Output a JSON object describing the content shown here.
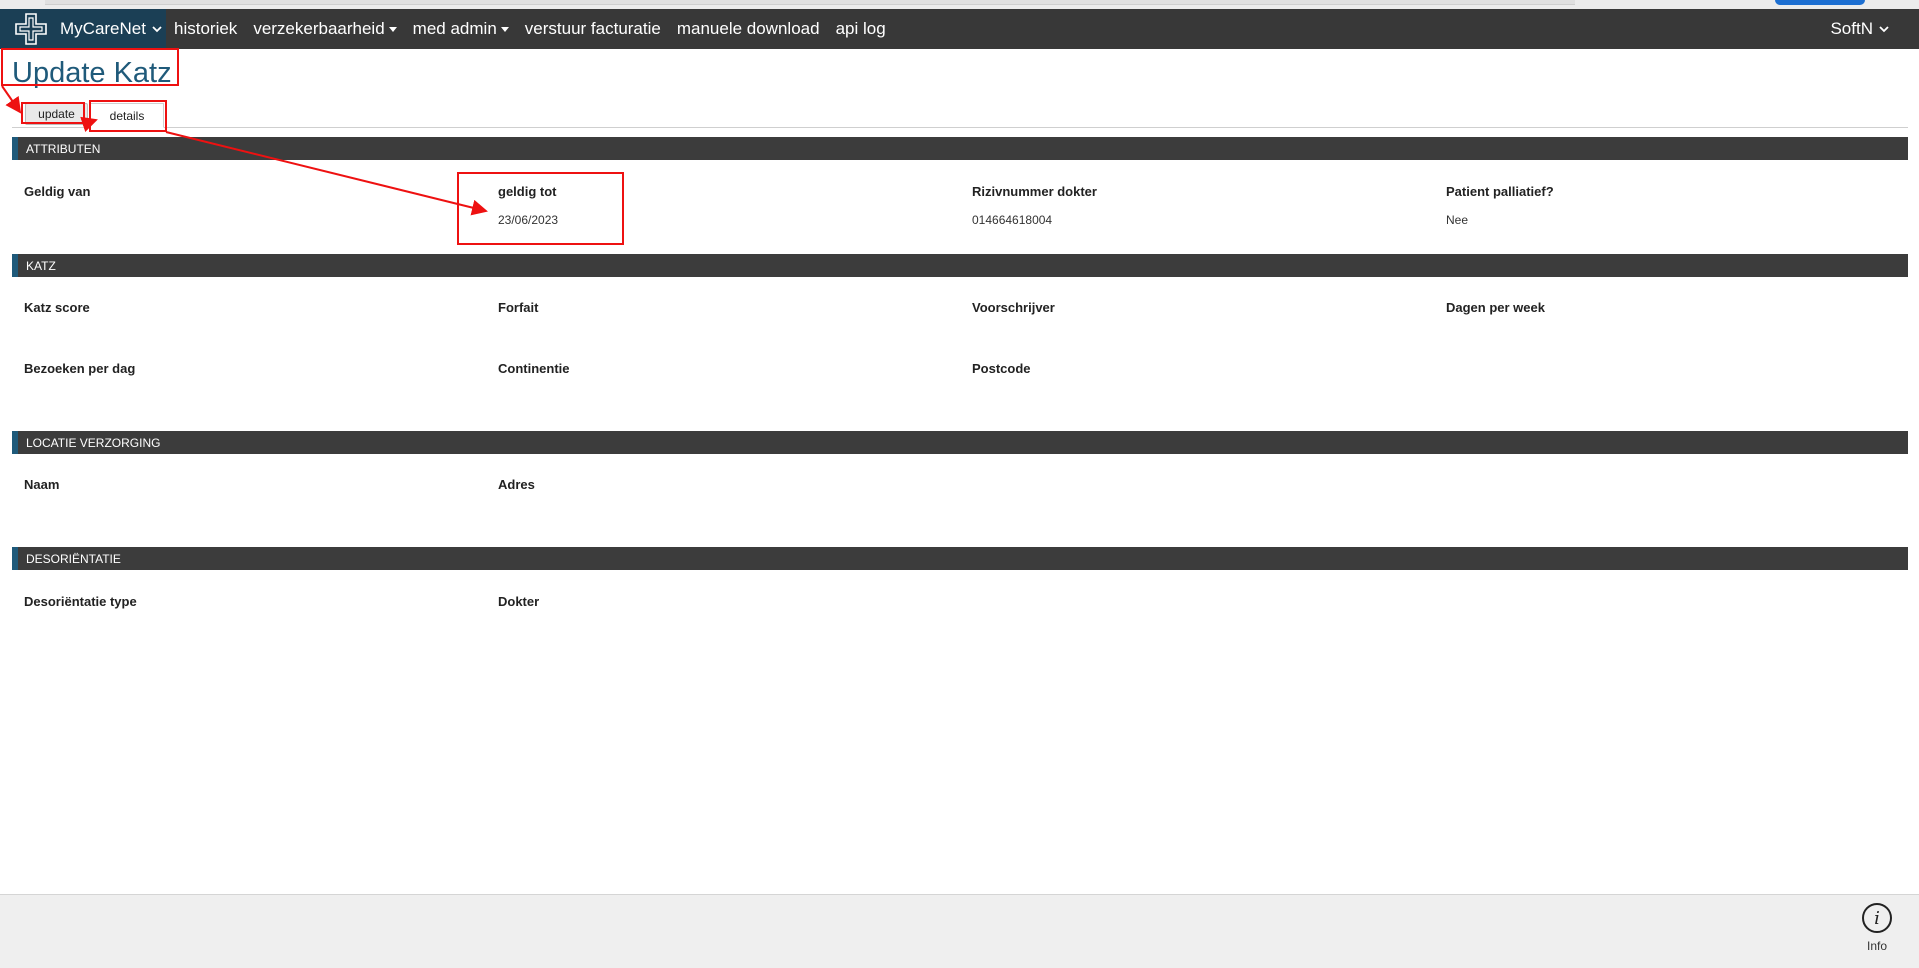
{
  "navbar": {
    "brand": "MyCareNet",
    "items": [
      {
        "label": "historiek",
        "dropdown": false
      },
      {
        "label": "verzekerbaarheid",
        "dropdown": true
      },
      {
        "label": "med admin",
        "dropdown": true
      },
      {
        "label": "verstuur facturatie",
        "dropdown": false
      },
      {
        "label": "manuele download",
        "dropdown": false
      },
      {
        "label": "api log",
        "dropdown": false
      }
    ],
    "user": "SoftN"
  },
  "page": {
    "title": "Update Katz",
    "tabs": [
      {
        "label": "update",
        "active": false
      },
      {
        "label": "details",
        "active": true
      }
    ]
  },
  "sections": {
    "attributen": {
      "header": "ATTRIBUTEN",
      "fields": [
        {
          "label": "Geldig van",
          "value": ""
        },
        {
          "label": "geldig tot",
          "value": "23/06/2023"
        },
        {
          "label": "Rizivnummer dokter",
          "value": "014664618004"
        },
        {
          "label": "Patient palliatief?",
          "value": "Nee"
        }
      ]
    },
    "katz": {
      "header": "KATZ",
      "fields": [
        {
          "label": "Katz score",
          "value": ""
        },
        {
          "label": "Forfait",
          "value": ""
        },
        {
          "label": "Voorschrijver",
          "value": ""
        },
        {
          "label": "Dagen per week",
          "value": ""
        },
        {
          "label": "Bezoeken per dag",
          "value": ""
        },
        {
          "label": "Continentie",
          "value": ""
        },
        {
          "label": "Postcode",
          "value": ""
        }
      ]
    },
    "locatie": {
      "header": "LOCATIE VERZORGING",
      "fields": [
        {
          "label": "Naam",
          "value": ""
        },
        {
          "label": "Adres",
          "value": ""
        }
      ]
    },
    "desorientatie": {
      "header": "DESORIËNTATIE",
      "fields": [
        {
          "label": "Desoriëntatie type",
          "value": ""
        },
        {
          "label": "Dokter",
          "value": ""
        }
      ]
    }
  },
  "footer": {
    "info_label": "Info",
    "info_icon": "info-icon"
  },
  "colors": {
    "navbar": "#383838",
    "brand": "#1b3f55",
    "title": "#1f5a7a",
    "section_header": "#3c3c3c",
    "annotation": "#e11111"
  }
}
